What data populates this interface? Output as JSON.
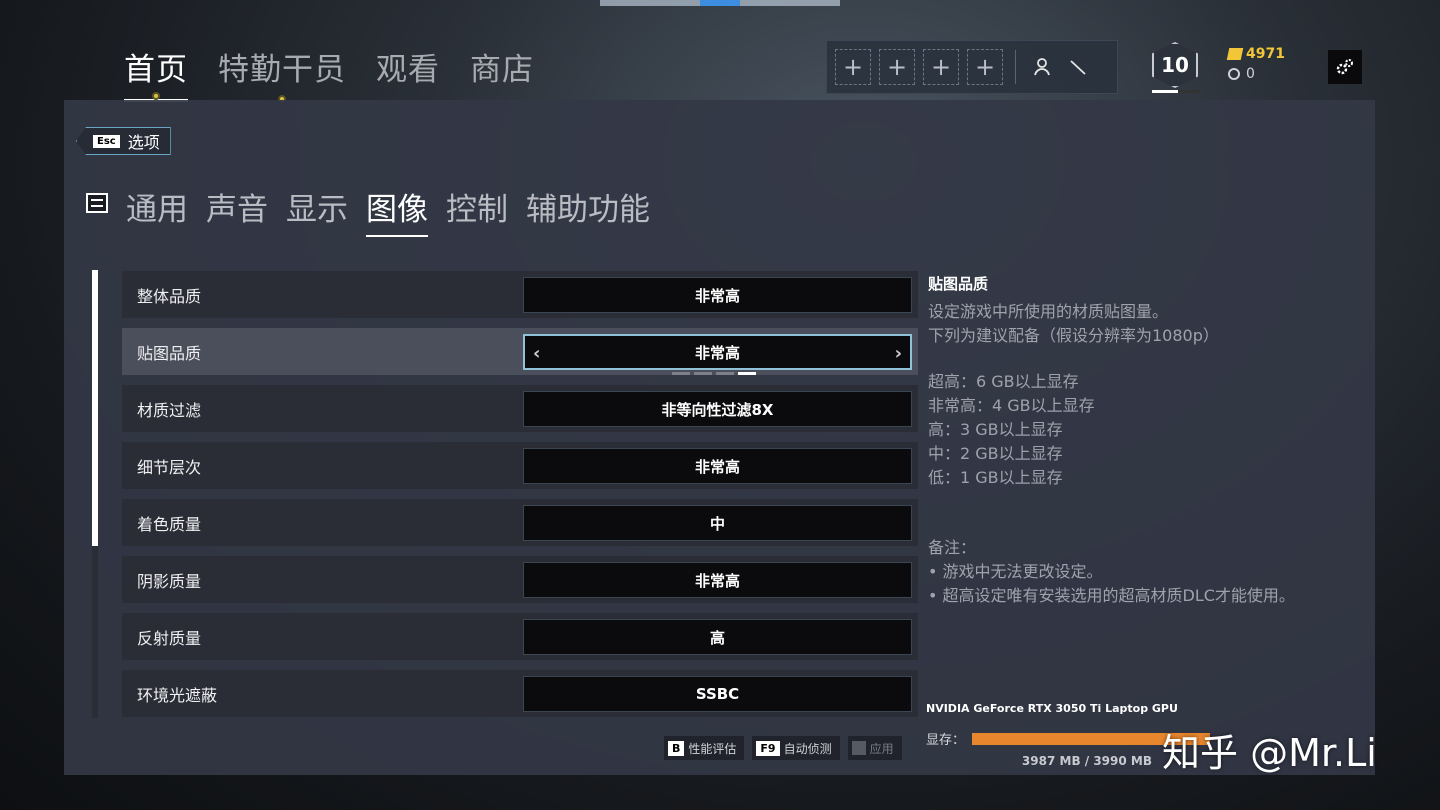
{
  "top_nav": {
    "tabs": [
      {
        "label": "首页"
      },
      {
        "label": "特勤干员"
      },
      {
        "label": "观看"
      },
      {
        "label": "商店"
      }
    ],
    "squad_slots": [
      "+",
      "+",
      "+",
      "+"
    ],
    "level": "10",
    "credits": "4971",
    "coins": "0"
  },
  "panel": {
    "back": {
      "key": "Esc",
      "label": "选项"
    },
    "tabs": [
      "通用",
      "声音",
      "显示",
      "图像",
      "控制",
      "辅助功能"
    ],
    "active_tab": "图像",
    "settings": [
      {
        "label": "整体品质",
        "value": "非常高"
      },
      {
        "label": "贴图品质",
        "value": "非常高"
      },
      {
        "label": "材质过滤",
        "value": "非等向性过滤8X"
      },
      {
        "label": "细节层次",
        "value": "非常高"
      },
      {
        "label": "着色质量",
        "value": "中"
      },
      {
        "label": "阴影质量",
        "value": "非常高"
      },
      {
        "label": "反射质量",
        "value": "高"
      },
      {
        "label": "环境光遮蔽",
        "value": "SSBC"
      }
    ],
    "selected_level": 4,
    "level_count": 4,
    "info": {
      "title": "贴图品质",
      "desc1": "设定游戏中所使用的材质贴图量。",
      "desc2": "下列为建议配备（假设分辨率为1080p）",
      "lines": [
        "超高：6 GB以上显存",
        "非常高：4 GB以上显存",
        "高：3 GB以上显存",
        "中：2 GB以上显存",
        "低：1 GB以上显存"
      ],
      "note_title": "备注：",
      "notes": [
        "• 游戏中无法更改设定。",
        "• 超高设定唯有安装选用的超高材质DLC才能使用。"
      ]
    },
    "gpu": {
      "name": "NVIDIA GeForce RTX 3050 Ti Laptop GPU",
      "vram_label": "显存：",
      "used_mb": 3987,
      "total_mb": 3990,
      "vram_text": "3987 MB / 3990 MB"
    },
    "footer": {
      "perf": {
        "key": "B",
        "label": "性能评估"
      },
      "auto": {
        "key": "F9",
        "label": "自动侦测"
      },
      "apply": {
        "label": "应用"
      }
    }
  },
  "watermark": "知乎 @Mr.Li",
  "colors": {
    "accent": "#8fc1d9",
    "credits": "#f2c636",
    "vram": "#e8862d"
  }
}
